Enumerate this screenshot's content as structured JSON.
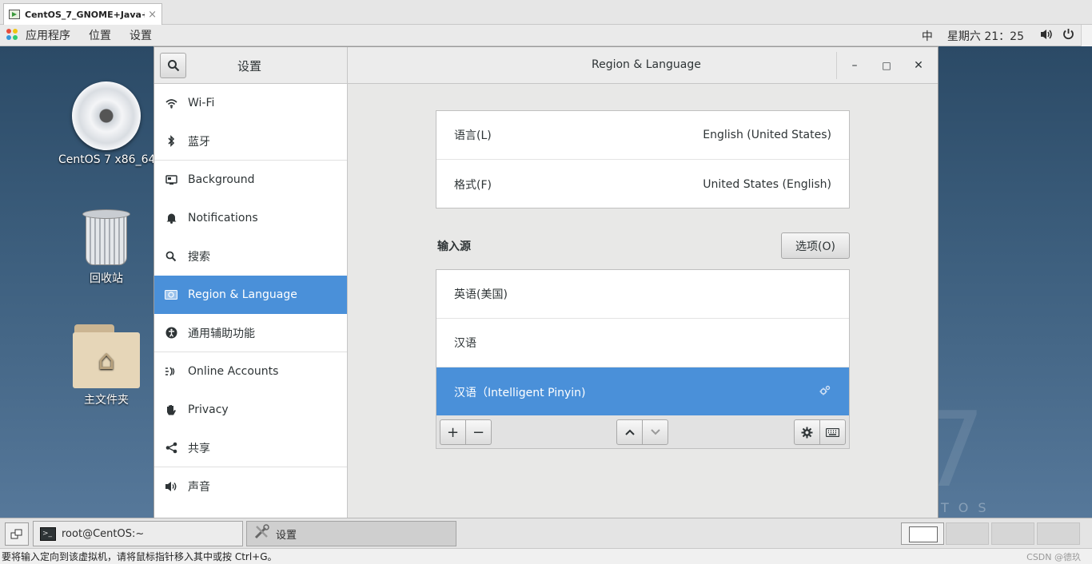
{
  "vm_tab": {
    "title": "CentOS_7_GNOME+Java+...",
    "close": "×"
  },
  "topbar": {
    "menu": [
      "应用程序",
      "位置",
      "设置"
    ],
    "input_method": "中",
    "clock": "星期六  21：25"
  },
  "desktop": {
    "icons": [
      {
        "label": "CentOS 7 x86_64"
      },
      {
        "label": "回收站"
      },
      {
        "label": "主文件夹"
      }
    ],
    "watermark_seven": "7",
    "watermark_text": "TOS"
  },
  "window": {
    "sidebar_title": "设置",
    "title": "Region & Language",
    "controls": {
      "minimize": "–",
      "maximize": "□",
      "close": "✕"
    }
  },
  "sidebar": {
    "items": [
      {
        "label": "Wi-Fi",
        "icon": "wifi-icon"
      },
      {
        "label": "蓝牙",
        "icon": "bluetooth-icon"
      },
      {
        "label": "Background",
        "icon": "background-icon"
      },
      {
        "label": "Notifications",
        "icon": "bell-icon"
      },
      {
        "label": "搜索",
        "icon": "search-icon"
      },
      {
        "label": "Region & Language",
        "icon": "region-icon",
        "selected": true
      },
      {
        "label": "通用辅助功能",
        "icon": "accessibility-icon"
      },
      {
        "label": "Online Accounts",
        "icon": "online-accounts-icon"
      },
      {
        "label": "Privacy",
        "icon": "hand-icon"
      },
      {
        "label": "共享",
        "icon": "share-icon"
      },
      {
        "label": "声音",
        "icon": "speaker-icon"
      }
    ]
  },
  "region": {
    "language_label": "语言(L)",
    "language_value": "English (United States)",
    "formats_label": "格式(F)",
    "formats_value": "United States (English)"
  },
  "input_sources": {
    "heading": "输入源",
    "options_button": "选项(O)",
    "items": [
      {
        "label": "英语(美国)"
      },
      {
        "label": "汉语"
      },
      {
        "label": "汉语（Intelligent Pinyin)",
        "selected": true
      }
    ],
    "toolbar": {
      "add": "+",
      "remove": "−"
    }
  },
  "taskbar": {
    "tasks": [
      "root@CentOS:~",
      "设置"
    ]
  },
  "statusbar": {
    "hint": "要将输入定向到该虚拟机，请将鼠标指针移入其中或按 Ctrl+G。",
    "watermark": "CSDN @德玖"
  },
  "colors": {
    "accent": "#4a90d9",
    "desktop": "#3d5f7e"
  }
}
